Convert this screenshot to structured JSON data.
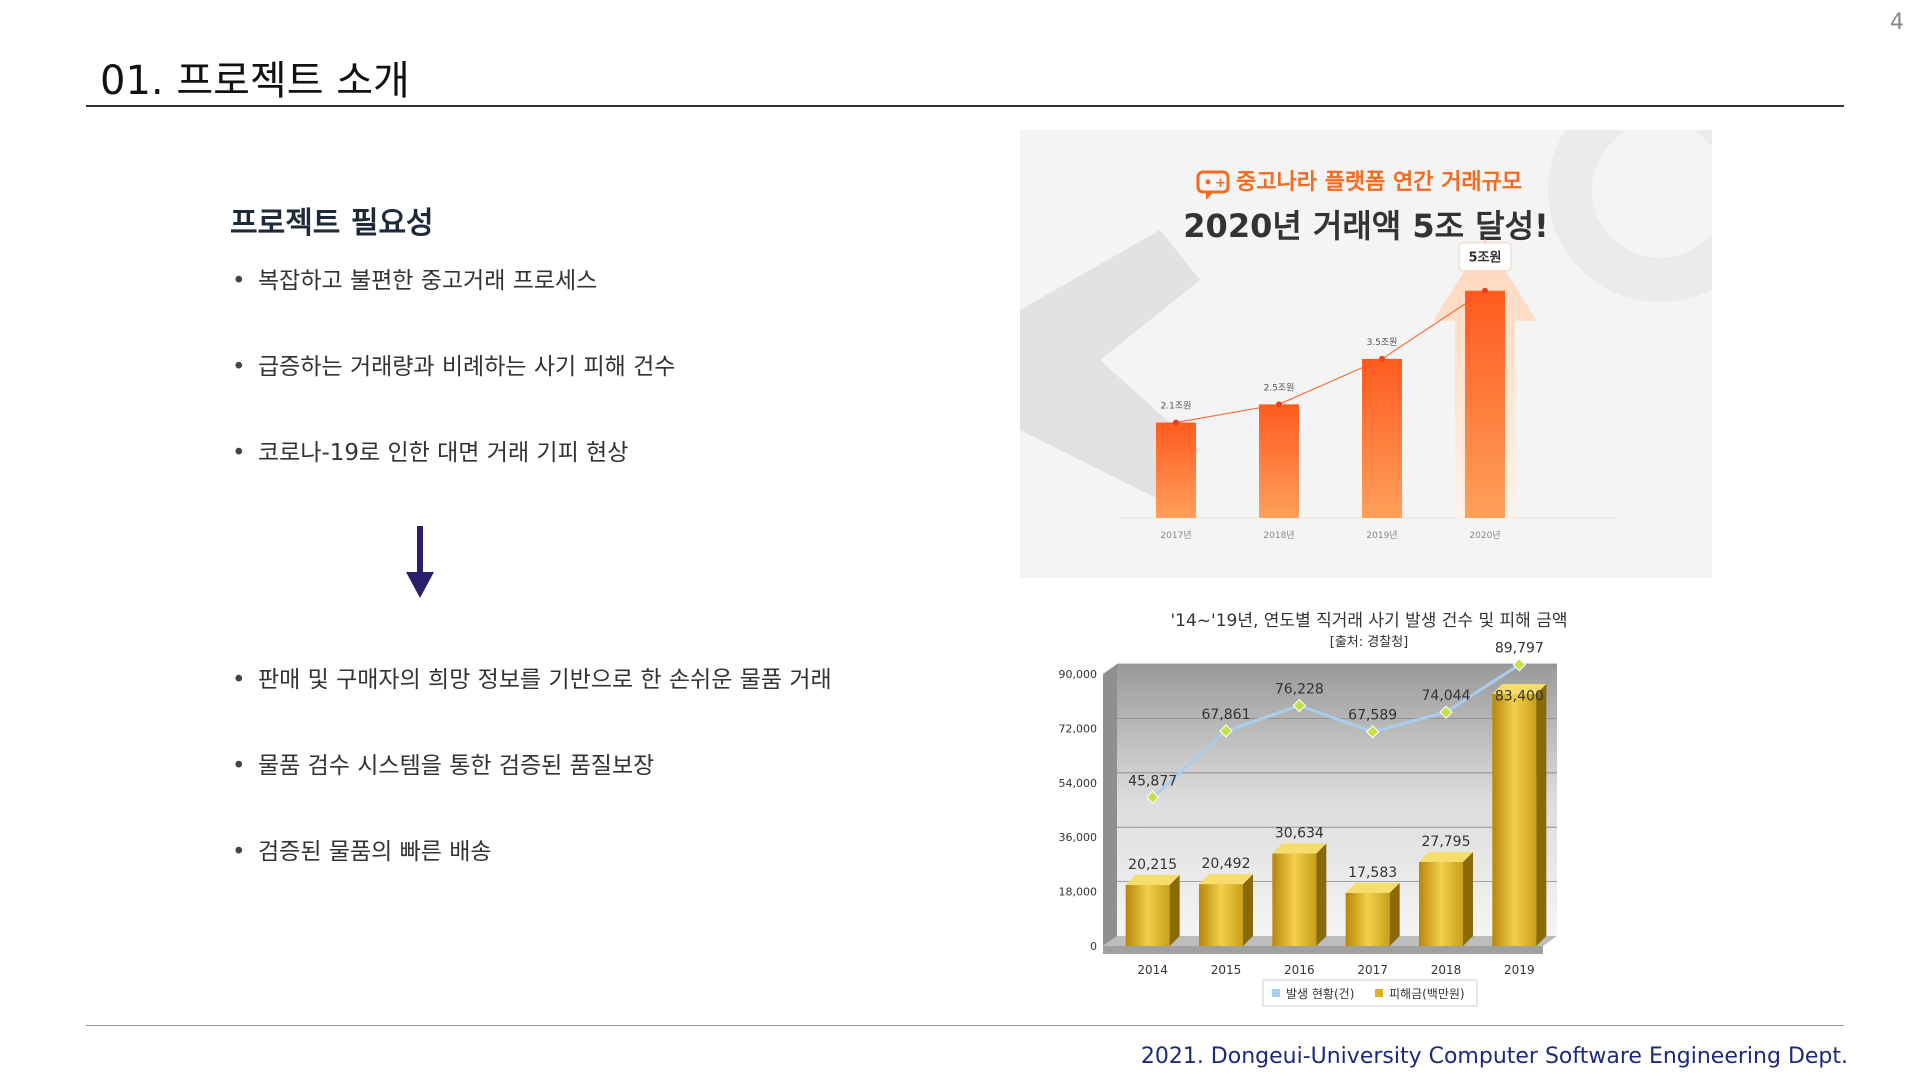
{
  "page_number": "4",
  "title": "01. 프로젝트 소개",
  "section_heading": "프로젝트 필요성",
  "problems": [
    "복잡하고 불편한 중고거래 프로세스",
    "급증하는 거래량과 비례하는 사기 피해 건수",
    "코로나-19로 인한 대면 거래 기피 현상"
  ],
  "solutions": [
    "판매 및 구매자의 희망 정보를 기반으로 한 손쉬운 물품 거래",
    "물품 검수 시스템을 통한 검증된 품질보장",
    "검증된 물품의 빠른 배송"
  ],
  "footer": "2021. Dongeui-University Computer Software Engineering Dept.",
  "colors": {
    "accent_orange": "#f26b21",
    "arrow": "#2a1f6b",
    "footer_text": "#1c2a7a",
    "gold": "#d4a017",
    "line_blue": "#a8cdee"
  },
  "chart_data": [
    {
      "type": "bar",
      "title": "2020년 거래액 5조 달성!",
      "subtitle": "중고나라 플랫폼 연간 거래규모",
      "categories": [
        "2017년",
        "2018년",
        "2019년",
        "2020년"
      ],
      "values": [
        2.1,
        2.5,
        3.5,
        5
      ],
      "value_labels": [
        "2.1조원",
        "2.5조원",
        "3.5조원",
        "5조원"
      ],
      "unit": "조원",
      "ylim": [
        0,
        5.5
      ],
      "grid": false
    },
    {
      "type": "bar",
      "title": "'14~'19년, 연도별 직거래 사기 발생 건수 및 피해 금액",
      "subtitle": "[출처: 경찰청]",
      "categories": [
        "2014",
        "2015",
        "2016",
        "2017",
        "2018",
        "2019"
      ],
      "series": [
        {
          "name": "발생 현황(건)",
          "kind": "line",
          "values": [
            45877,
            67861,
            76228,
            67589,
            74044,
            89797
          ]
        },
        {
          "name": "피해금(백만원)",
          "kind": "bar",
          "values": [
            20215,
            20492,
            30634,
            17583,
            27795,
            83400
          ]
        }
      ],
      "y_ticks": [
        "0",
        "18,000",
        "36,000",
        "54,000",
        "72,000",
        "90,000"
      ],
      "ylim": [
        0,
        90000
      ],
      "grid": true,
      "legend": "bottom"
    }
  ]
}
